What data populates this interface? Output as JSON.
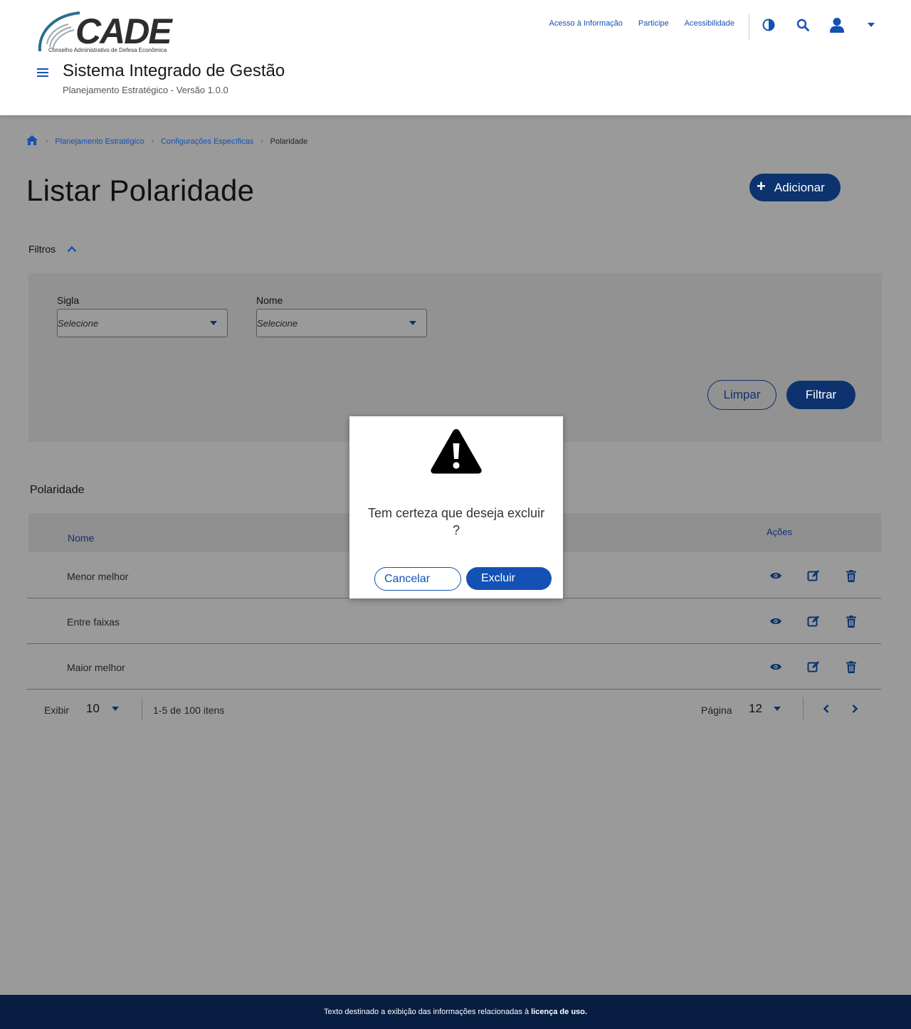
{
  "header": {
    "logo_text": "CADE",
    "logo_subtitle": "Conselho Administrativo de Defesa Econômica",
    "links": [
      "Acesso à Informação",
      "Participe",
      "Acessibilidade"
    ],
    "system_title": "Sistema Integrado de Gestão",
    "system_subtitle": "Planejamento Estratégico - Versão 1.0.0",
    "icons": [
      "contrast-icon",
      "search-icon",
      "user-icon",
      "caret-down-icon"
    ]
  },
  "breadcrumb": {
    "items": [
      "Planejamento Estratégico",
      "Configurações Específicas"
    ],
    "current": "Polaridade"
  },
  "page": {
    "title": "Listar Polaridade",
    "add_label": "Adicionar"
  },
  "filters": {
    "toggle_label": "Filtros",
    "sigla_label": "Sigla",
    "sigla_value": "Selecione",
    "nome_label": "Nome",
    "nome_value": "Selecione",
    "clear_label": "Limpar",
    "filter_label": "Filtrar"
  },
  "table": {
    "title": "Polaridade",
    "columns": [
      "Nome",
      "Ações"
    ],
    "rows": [
      "Menor melhor",
      "Entre faixas",
      "Maior melhor"
    ],
    "row_actions": [
      "view-icon",
      "edit-icon",
      "delete-icon"
    ]
  },
  "pagination": {
    "show_label": "Exibir",
    "show_value": "10",
    "range_text": "1-5 de 100 itens",
    "page_label": "Página",
    "page_value": "12"
  },
  "modal": {
    "message": "Tem certeza que deseja excluir ?",
    "cancel_label": "Cancelar",
    "confirm_label": "Excluir"
  },
  "footer": {
    "text": "Texto destinado a exibição das informações relacionadas à",
    "link": "licença de uso."
  },
  "colors": {
    "primary": "#1351b4",
    "primary_dark": "#0c326f",
    "overlay_bg": "#9a9a9a",
    "footer_bg": "#071d41"
  }
}
